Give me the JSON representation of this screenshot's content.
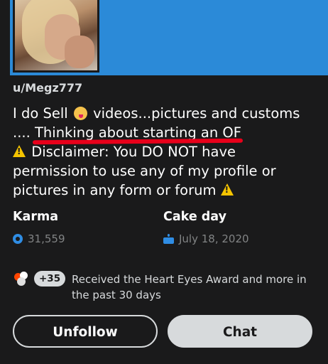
{
  "profile": {
    "username": "u/Megz777",
    "bio": {
      "line1_prefix": "I do Sell",
      "line1_suffix": "videos...pictures and customs",
      "line2_prefix": "....",
      "line2_highlight": "Thinking about starting an OF",
      "line3": "Disclaimer: You DO NOT have",
      "line4": "permission to use any of my profile or",
      "line5": "pictures in any form or forum",
      "emoji_icon": "tongue-wink-emoji",
      "warning_icon": "warning-icon"
    }
  },
  "stats": {
    "karma_label": "Karma",
    "karma_value": "31,559",
    "cake_label": "Cake day",
    "cake_value": "July 18, 2020"
  },
  "awards": {
    "count": "+35",
    "text": "Received the Heart Eyes Award and more in the past 30 days"
  },
  "actions": {
    "unfollow_label": "Unfollow",
    "chat_label": "Chat"
  },
  "colors": {
    "banner": "#2b8ad8",
    "background": "#1a1a1b",
    "annotation_underline": "#e8001a",
    "accent_icon": "#2f8de4"
  }
}
